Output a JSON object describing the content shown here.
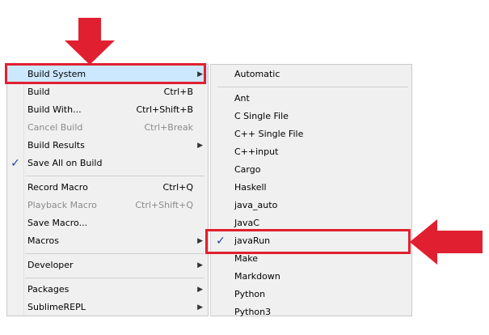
{
  "left_menu": {
    "items": [
      {
        "label": "Build System",
        "shortcut": "",
        "submenu": true,
        "disabled": false,
        "checked": false
      },
      {
        "label": "Build",
        "shortcut": "Ctrl+B",
        "submenu": false,
        "disabled": false,
        "checked": false
      },
      {
        "label": "Build With...",
        "shortcut": "Ctrl+Shift+B",
        "submenu": false,
        "disabled": false,
        "checked": false
      },
      {
        "label": "Cancel Build",
        "shortcut": "Ctrl+Break",
        "submenu": false,
        "disabled": true,
        "checked": false
      },
      {
        "label": "Build Results",
        "shortcut": "",
        "submenu": true,
        "disabled": false,
        "checked": false
      },
      {
        "label": "Save All on Build",
        "shortcut": "",
        "submenu": false,
        "disabled": false,
        "checked": true
      },
      {
        "label": "Record Macro",
        "shortcut": "Ctrl+Q",
        "submenu": false,
        "disabled": false,
        "checked": false
      },
      {
        "label": "Playback Macro",
        "shortcut": "Ctrl+Shift+Q",
        "submenu": false,
        "disabled": true,
        "checked": false
      },
      {
        "label": "Save Macro...",
        "shortcut": "",
        "submenu": false,
        "disabled": false,
        "checked": false
      },
      {
        "label": "Macros",
        "shortcut": "",
        "submenu": true,
        "disabled": false,
        "checked": false
      },
      {
        "label": "Developer",
        "shortcut": "",
        "submenu": true,
        "disabled": false,
        "checked": false
      },
      {
        "label": "Packages",
        "shortcut": "",
        "submenu": true,
        "disabled": false,
        "checked": false
      },
      {
        "label": "SublimeREPL",
        "shortcut": "",
        "submenu": true,
        "disabled": false,
        "checked": false
      }
    ]
  },
  "right_menu": {
    "items": [
      {
        "label": "Automatic",
        "checked": false
      },
      {
        "label": "Ant",
        "checked": false
      },
      {
        "label": "C Single File",
        "checked": false
      },
      {
        "label": "C++ Single File",
        "checked": false
      },
      {
        "label": "C++input",
        "checked": false
      },
      {
        "label": "Cargo",
        "checked": false
      },
      {
        "label": "Haskell",
        "checked": false
      },
      {
        "label": "java_auto",
        "checked": false
      },
      {
        "label": "JavaC",
        "checked": false
      },
      {
        "label": "javaRun",
        "checked": true
      },
      {
        "label": "Make",
        "checked": false
      },
      {
        "label": "Markdown",
        "checked": false
      },
      {
        "label": "Python",
        "checked": false
      },
      {
        "label": "Python3",
        "checked": false
      }
    ]
  },
  "icons": {
    "submenu_arrow": "submenu-arrow-icon",
    "checkmark": "checkmark-icon",
    "down_arrow": "red-down-arrow-icon",
    "left_arrow": "red-left-arrow-icon"
  },
  "colors": {
    "annotation_red": "#e02030",
    "highlight": "#cce8ff",
    "menu_bg": "#f0f0f0",
    "check_blue": "#1f3ea8"
  }
}
